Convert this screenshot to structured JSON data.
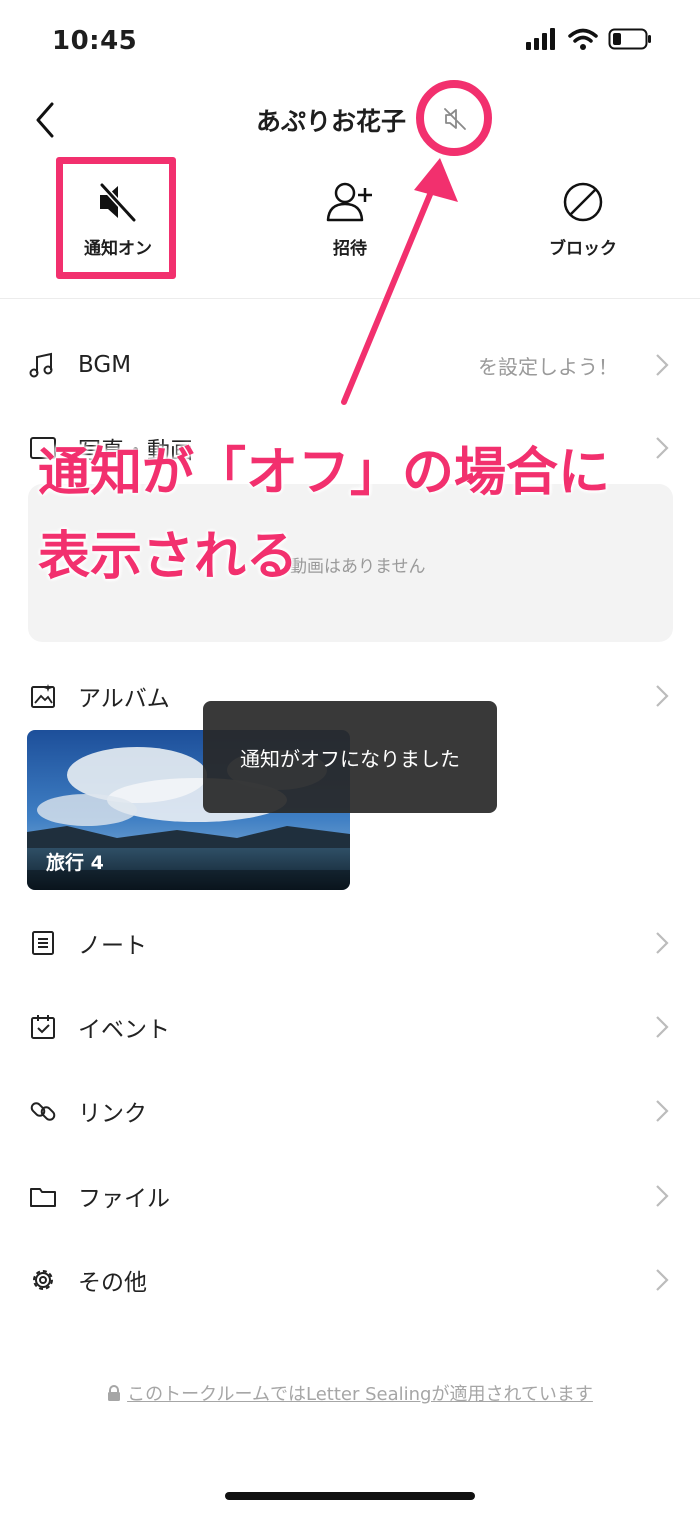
{
  "status_bar": {
    "time": "10:45"
  },
  "header": {
    "title": "あぷりお花子"
  },
  "actions": [
    {
      "label": "通知オン",
      "icon": "speaker-muted-icon"
    },
    {
      "label": "招待",
      "icon": "add-user-icon"
    },
    {
      "label": "ブロック",
      "icon": "block-icon"
    }
  ],
  "menu": {
    "bgm": {
      "label": "BGM",
      "hint": "を設定しよう！"
    },
    "video": {
      "label": "写真・動画",
      "empty_text": "動画はありません"
    },
    "album": {
      "label": "アルバム",
      "card_label": "旅行 4"
    },
    "note": {
      "label": "ノート"
    },
    "event": {
      "label": "イベント"
    },
    "link": {
      "label": "リンク"
    },
    "file": {
      "label": "ファイル"
    },
    "other": {
      "label": "その他"
    }
  },
  "toast": {
    "text": "通知がオフになりました"
  },
  "footer": {
    "text": "このトークルームではLetter Sealingが適用されています"
  },
  "annotation": {
    "line1": "通知が「オフ」の場合に",
    "line2": "表示される",
    "color": "#f2306e"
  }
}
